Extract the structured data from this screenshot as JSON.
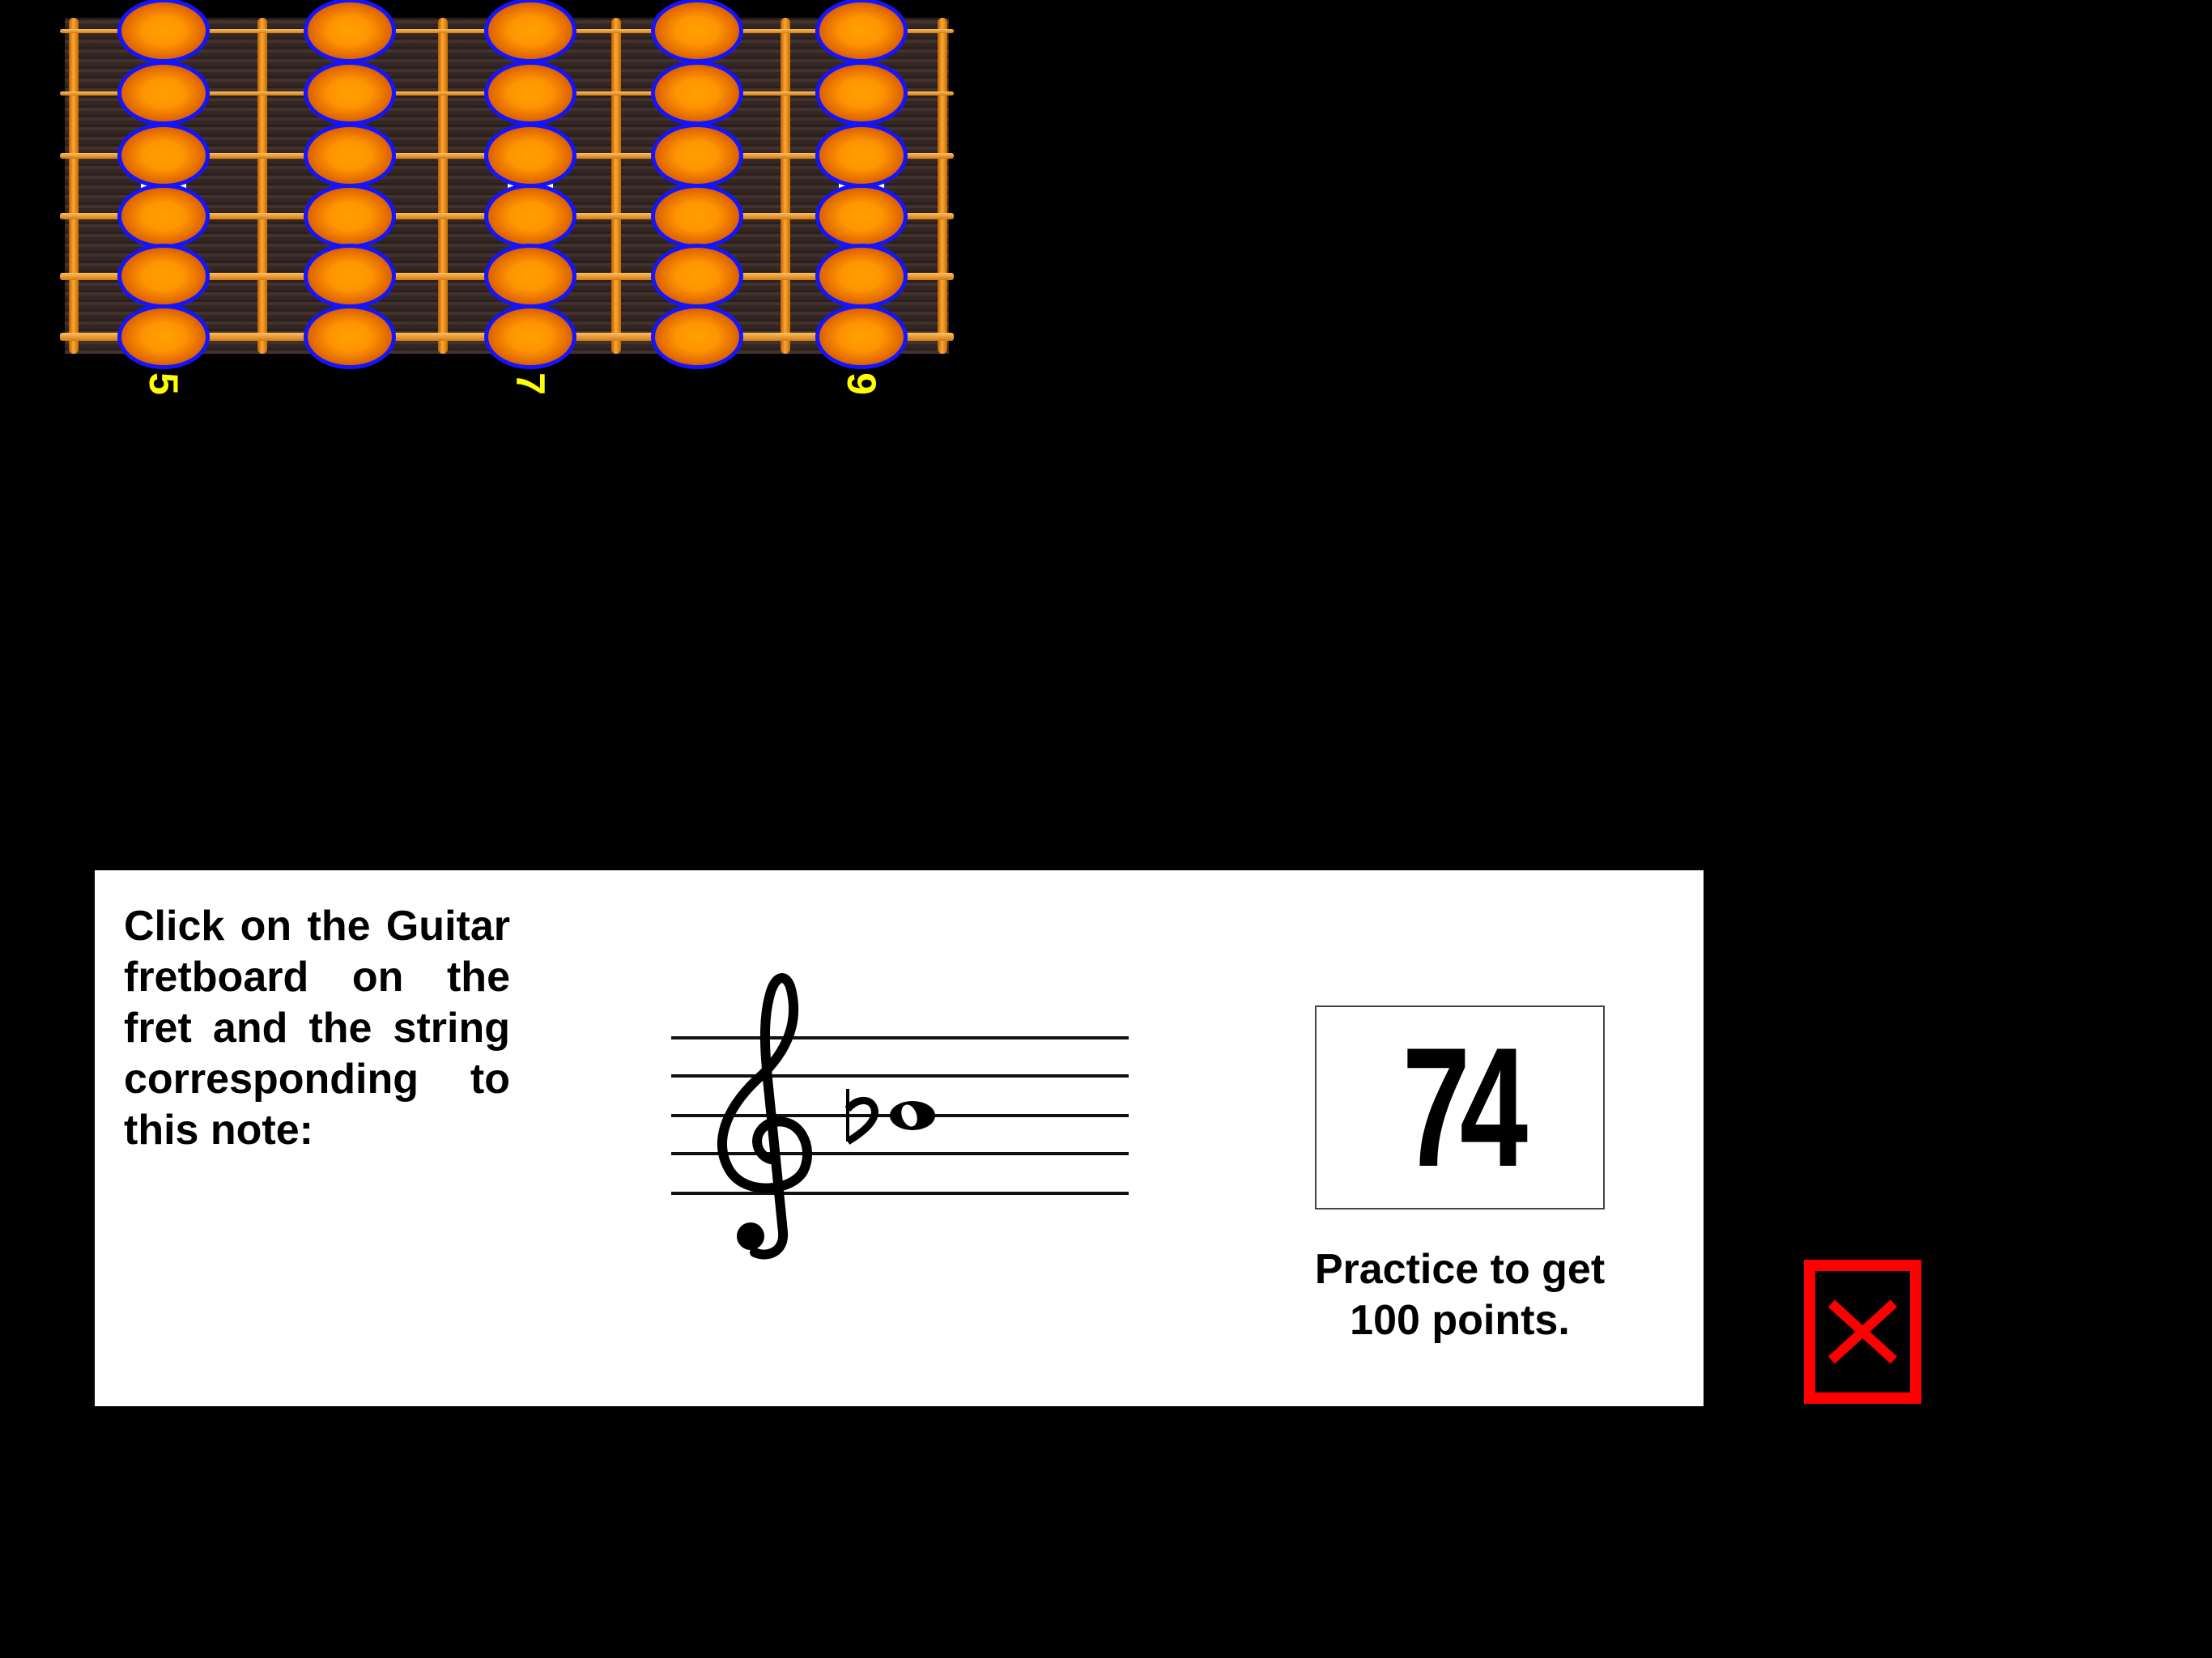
{
  "fretboard": {
    "frets": [
      5,
      6,
      7,
      8,
      9
    ],
    "string_count": 6,
    "fret_labels": {
      "5": "5",
      "7": "7",
      "9": "9"
    },
    "marker_frets": [
      5,
      7,
      9
    ],
    "colors": {
      "dot_fill": "#ff9500",
      "dot_border": "#1414ff",
      "label": "#ffff00",
      "wood": "#3a2a27"
    }
  },
  "panel": {
    "instruction": "Click on the Guitar fretboard on the fret and the string corresponding to this note:",
    "note": {
      "clef": "treble",
      "pitch": "Bb4",
      "accidental": "flat",
      "duration": "whole"
    },
    "score": "74",
    "practice_message_line1": "Practice to get",
    "practice_message_line2": "100 points."
  },
  "close_button": {
    "icon": "close-icon",
    "color": "#ff0000"
  }
}
